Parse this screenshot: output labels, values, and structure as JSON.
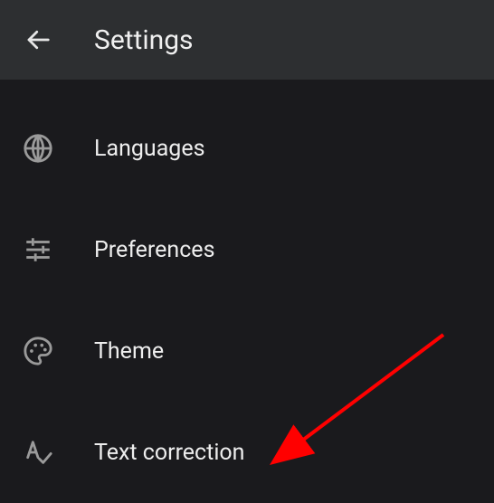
{
  "header": {
    "title": "Settings"
  },
  "items": [
    {
      "label": "Languages"
    },
    {
      "label": "Preferences"
    },
    {
      "label": "Theme"
    },
    {
      "label": "Text correction"
    }
  ]
}
